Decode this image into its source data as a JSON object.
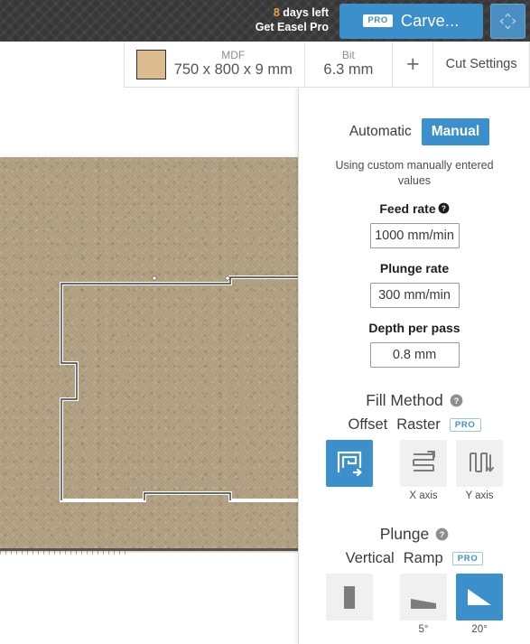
{
  "topbar": {
    "trial_days": "8",
    "trial_days_suffix": " days left",
    "trial_cta": "Get Easel Pro",
    "carve_pro_badge": "PRO",
    "carve_label": "Carve...",
    "move_icon_name": "four-way-arrows"
  },
  "toolbar": {
    "material": {
      "sub": "MDF",
      "main": "750 x 800 x 9 mm",
      "swatch_color": "#dcbb8e"
    },
    "bit": {
      "sub": "Bit",
      "main": "6.3 mm"
    },
    "add_label": "+",
    "cut_settings_label": "Cut Settings"
  },
  "panel": {
    "mode_tabs": [
      {
        "label": "Automatic",
        "active": false
      },
      {
        "label": "Manual",
        "active": true
      }
    ],
    "mode_hint": "Using custom manually entered values",
    "fields": [
      {
        "label": "Feed rate",
        "value": "1000 mm/min",
        "has_help": true
      },
      {
        "label": "Plunge rate",
        "value": "300 mm/min",
        "has_help": false
      },
      {
        "label": "Depth per pass",
        "value": "0.8 mm",
        "has_help": false
      }
    ],
    "fill_method": {
      "title": "Fill Method",
      "help_icon": "question-circle-icon",
      "offset_label": "Offset",
      "raster_label": "Raster",
      "pro_badge": "PRO",
      "options": [
        {
          "name": "offset",
          "caption": "",
          "selected": true
        },
        {
          "name": "raster-x",
          "caption": "X axis",
          "selected": false
        },
        {
          "name": "raster-y",
          "caption": "Y axis",
          "selected": false
        }
      ]
    },
    "plunge": {
      "title": "Plunge",
      "help_icon": "question-circle-icon",
      "vertical_label": "Vertical",
      "ramp_label": "Ramp",
      "pro_badge": "PRO",
      "options": [
        {
          "name": "vertical",
          "caption": "",
          "selected": false
        },
        {
          "name": "ramp-5",
          "caption": "5°",
          "selected": false
        },
        {
          "name": "ramp-20",
          "caption": "20°",
          "selected": true
        }
      ]
    }
  },
  "colors": {
    "accent_blue": "#3b8fcb",
    "topbar_dark": "#3c3c3c",
    "trial_orange": "#e8a33d",
    "material_tan": "#b1a181",
    "tile_gray": "#f0f0f0"
  }
}
